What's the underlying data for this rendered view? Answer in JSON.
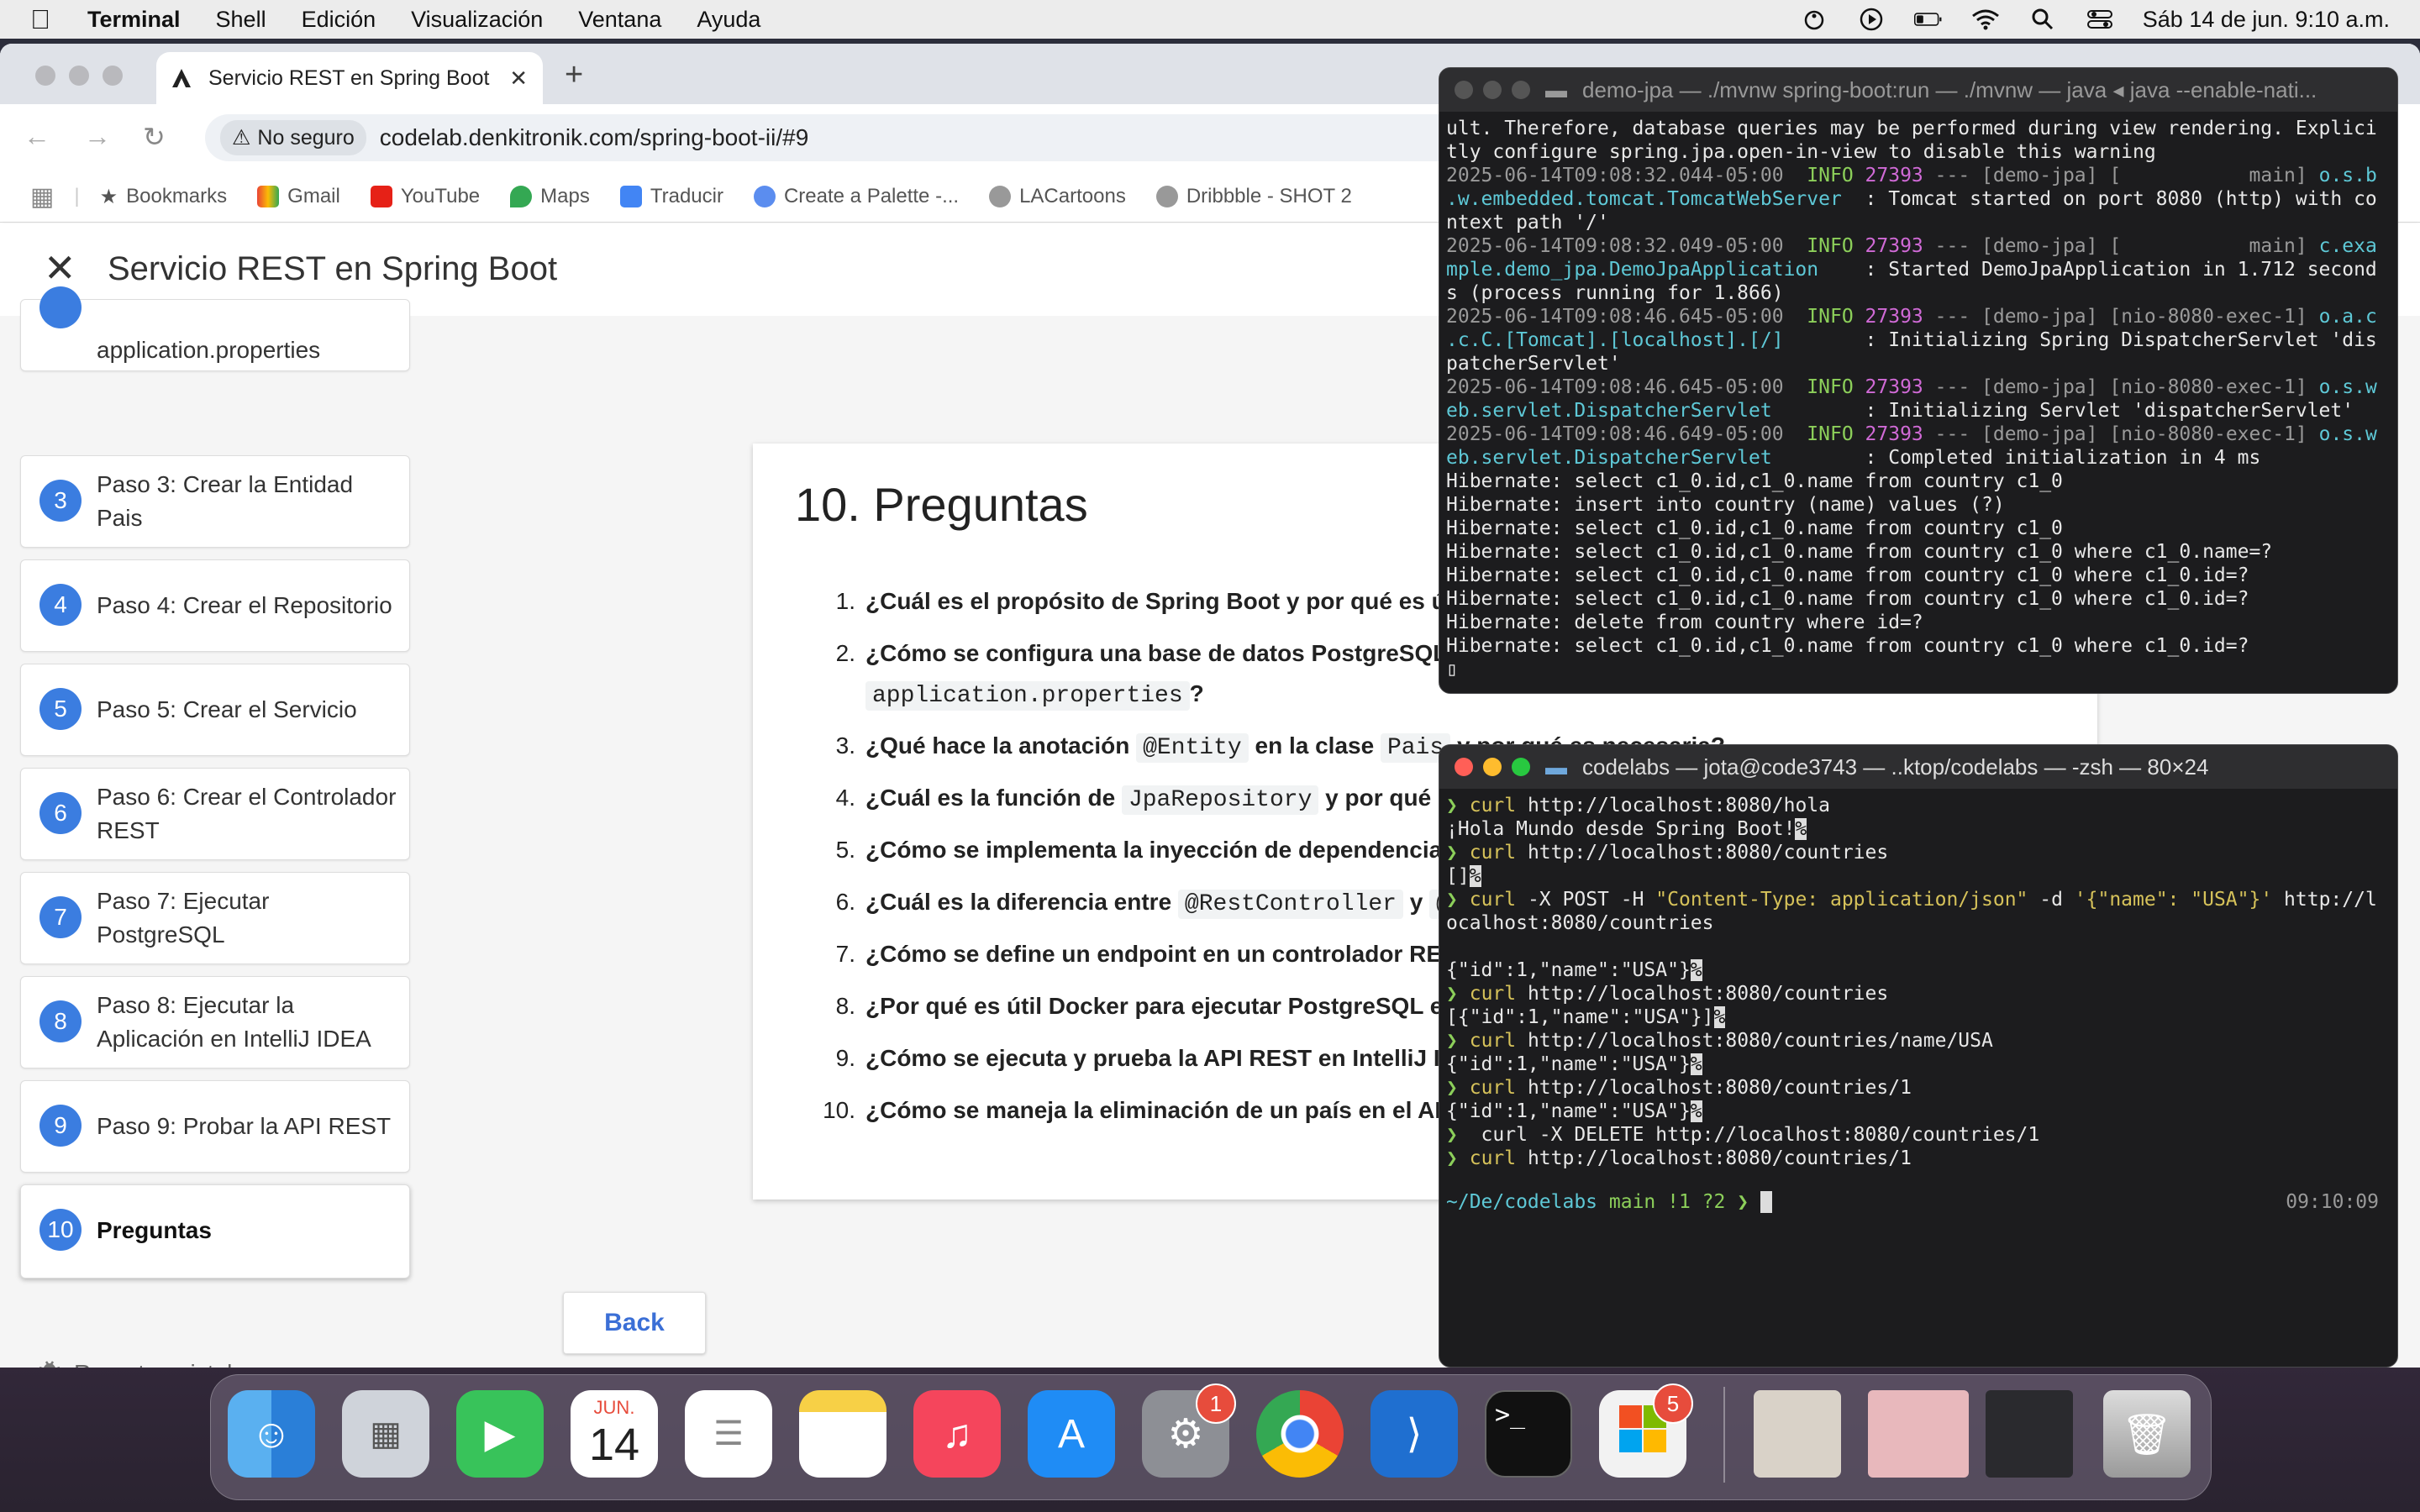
{
  "menubar": {
    "app": "Terminal",
    "items": [
      "Shell",
      "Edición",
      "Visualización",
      "Ventana",
      "Ayuda"
    ],
    "clock": "Sáb 14 de jun.  9:10 a.m."
  },
  "browser": {
    "tab_title": "Servicio REST en Spring Boot",
    "security_label": "No seguro",
    "url": "codelab.denkitronik.com/spring-boot-ii/#9",
    "bookmarks": [
      "Bookmarks",
      "Gmail",
      "YouTube",
      "Maps",
      "Traducir",
      "Create a Palette -...",
      "LACartoons",
      "Dribbble - SHOT 2"
    ]
  },
  "codelab": {
    "title": "Servicio REST en Spring Boot",
    "steps": [
      {
        "num": "",
        "label": "application.properties"
      },
      {
        "num": "3",
        "label": "Paso 3: Crear la Entidad Pais"
      },
      {
        "num": "4",
        "label": "Paso 4: Crear el Repositorio"
      },
      {
        "num": "5",
        "label": "Paso 5: Crear el Servicio"
      },
      {
        "num": "6",
        "label": "Paso 6: Crear el Controlador REST"
      },
      {
        "num": "7",
        "label": "Paso 7: Ejecutar PostgreSQL"
      },
      {
        "num": "8",
        "label": "Paso 8: Ejecutar la Aplicación en IntelliJ IDEA"
      },
      {
        "num": "9",
        "label": "Paso 9: Probar la API REST"
      },
      {
        "num": "10",
        "label": "Preguntas"
      }
    ],
    "heading": "10. Preguntas",
    "questions": [
      {
        "n": "1.",
        "a": "¿Cuál es el propósito de Spring Boot y por qué es útil en"
      },
      {
        "n": "2.",
        "a": "¿Cómo se configura una base de datos PostgreSQL en",
        "code": "application.properties",
        "b": "?"
      },
      {
        "n": "3.",
        "a": "¿Qué hace la anotación",
        "code": "@Entity",
        "b": "en la clase",
        "code2": "Pais",
        "c": "y por qué es necesaria?"
      },
      {
        "n": "4.",
        "a": "¿Cuál es la función de",
        "code": "JpaRepository",
        "b": "y por qué se u"
      },
      {
        "n": "5.",
        "a": "¿Cómo se implementa la inyección de dependencias en"
      },
      {
        "n": "6.",
        "a": "¿Cuál es la diferencia entre",
        "code": "@RestController",
        "b": "y",
        "code2": "@S"
      },
      {
        "n": "7.",
        "a": "¿Cómo se define un endpoint en un controlador REST p"
      },
      {
        "n": "8.",
        "a": "¿Por qué es útil Docker para ejecutar PostgreSQL en lu"
      },
      {
        "n": "9.",
        "a": "¿Cómo se ejecuta y prueba la API REST en IntelliJ IDEA"
      },
      {
        "n": "10.",
        "a": "¿Cómo se maneja la eliminación de un país en el API y"
      }
    ],
    "back_label": "Back",
    "report_label": "Report a mistake"
  },
  "terminal_top": {
    "title": "demo-jpa — ./mvnw spring-boot:run — ./mvnw — java ◂ java --enable-nati..."
  },
  "terminal_bottom": {
    "title": "codelabs — jota@code3743 — ..ktop/codelabs — -zsh — 80×24",
    "prompt_dir": "~/De/codelabs",
    "prompt_branch": "main !1 ?2",
    "prompt_time": "09:10:09"
  },
  "dock": {
    "calendar_month": "JUN.",
    "calendar_day": "14",
    "settings_badge": "1",
    "office_badge": "5"
  }
}
